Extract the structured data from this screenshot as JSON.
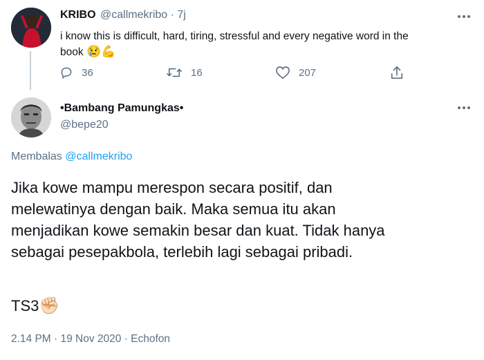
{
  "colors": {
    "accent": "#1da1f2",
    "muted": "#5b7083",
    "text": "#0f1419",
    "thread_line": "#c4cfd6"
  },
  "parent_tweet": {
    "name": "KRIBO",
    "handle": "@callmekribo",
    "separator": "·",
    "time": "7j",
    "text": "i know this is difficult, hard, tiring, stressful and every negative word in the",
    "text_line2": "book",
    "emojis": "😢💪",
    "actions": {
      "reply": {
        "icon": "reply-icon",
        "count": "36"
      },
      "retweet": {
        "icon": "retweet-icon",
        "count": "16"
      },
      "like": {
        "icon": "heart-icon",
        "count": "207"
      },
      "share": {
        "icon": "share-icon"
      }
    }
  },
  "main_tweet": {
    "name": "•Bambang Pamungkas•",
    "handle": "@bepe20",
    "reply_prefix": "Membalas",
    "reply_to": "@callmekribo",
    "lines": [
      "Jika kowe mampu merespon secara positif, dan",
      "melewatinya dengan baik. Maka semua itu akan",
      "menjadikan kowe semakin besar dan kuat. Tidak hanya",
      "sebagai pesepakbola, terlebih lagi sebagai pribadi."
    ],
    "signature": "TS3",
    "signature_emoji": "✊🏻",
    "timestamp": "2.14 PM · 19 Nov 2020 · Echofon"
  }
}
